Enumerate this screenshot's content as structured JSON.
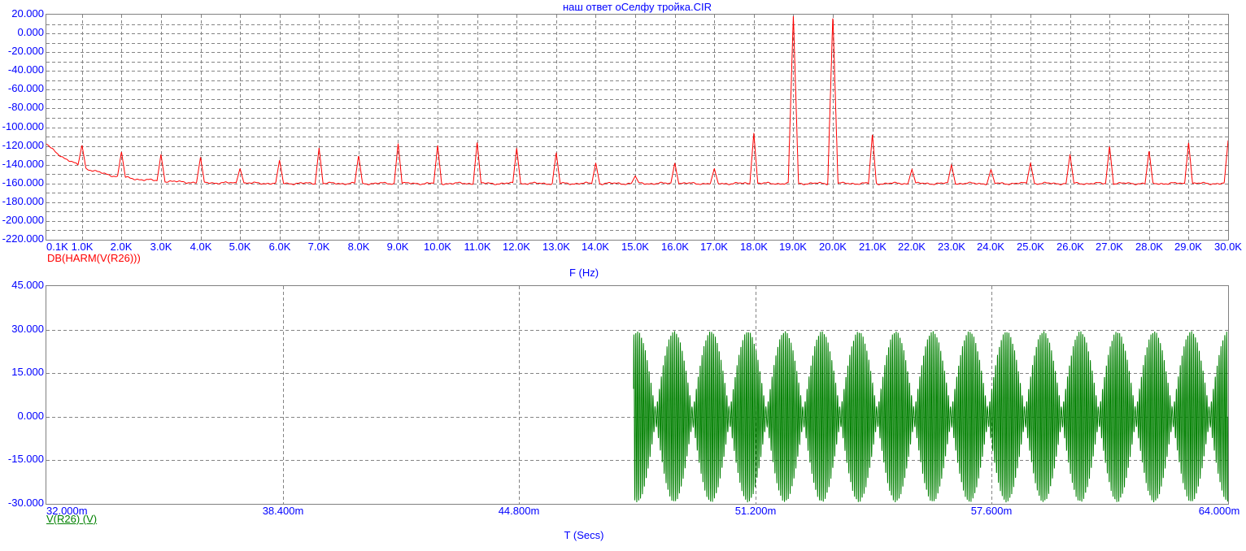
{
  "window_title": "наш ответ оСелфу тройка.CIR",
  "colors": {
    "label_blue": "#0000ff",
    "trace_red": "#ff0000",
    "trace_green": "#008000",
    "grid_gray": "#848484",
    "border_gray": "#808080",
    "background": "#ffffff"
  },
  "top_chart": {
    "series_label": "DB(HARM(V(R26)))",
    "xlabel": "F (Hz)",
    "y_ticks": [
      {
        "label": "20.000",
        "db": 20
      },
      {
        "label": "0.000",
        "db": 0
      },
      {
        "label": "-20.000",
        "db": -20
      },
      {
        "label": "-40.000",
        "db": -40
      },
      {
        "label": "-60.000",
        "db": -60
      },
      {
        "label": "-80.000",
        "db": -80
      },
      {
        "label": "-100.000",
        "db": -100
      },
      {
        "label": "-120.000",
        "db": -120
      },
      {
        "label": "-140.000",
        "db": -140
      },
      {
        "label": "-160.000",
        "db": -160
      },
      {
        "label": "-180.000",
        "db": -180
      },
      {
        "label": "-200.000",
        "db": -200
      },
      {
        "label": "-220.000",
        "db": -220
      }
    ],
    "x_ticks": [
      {
        "label": "0.1K",
        "khz": 0.1
      },
      {
        "label": "1.0K",
        "khz": 1
      },
      {
        "label": "2.0K",
        "khz": 2
      },
      {
        "label": "3.0K",
        "khz": 3
      },
      {
        "label": "4.0K",
        "khz": 4
      },
      {
        "label": "5.0K",
        "khz": 5
      },
      {
        "label": "6.0K",
        "khz": 6
      },
      {
        "label": "7.0K",
        "khz": 7
      },
      {
        "label": "8.0K",
        "khz": 8
      },
      {
        "label": "9.0K",
        "khz": 9
      },
      {
        "label": "10.0K",
        "khz": 10
      },
      {
        "label": "11.0K",
        "khz": 11
      },
      {
        "label": "12.0K",
        "khz": 12
      },
      {
        "label": "13.0K",
        "khz": 13
      },
      {
        "label": "14.0K",
        "khz": 14
      },
      {
        "label": "15.0K",
        "khz": 15
      },
      {
        "label": "16.0K",
        "khz": 16
      },
      {
        "label": "17.0K",
        "khz": 17
      },
      {
        "label": "18.0K",
        "khz": 18
      },
      {
        "label": "19.0K",
        "khz": 19
      },
      {
        "label": "20.0K",
        "khz": 20
      },
      {
        "label": "21.0K",
        "khz": 21
      },
      {
        "label": "22.0K",
        "khz": 22
      },
      {
        "label": "23.0K",
        "khz": 23
      },
      {
        "label": "24.0K",
        "khz": 24
      },
      {
        "label": "25.0K",
        "khz": 25
      },
      {
        "label": "26.0K",
        "khz": 26
      },
      {
        "label": "27.0K",
        "khz": 27
      },
      {
        "label": "28.0K",
        "khz": 28
      },
      {
        "label": "29.0K",
        "khz": 29
      },
      {
        "label": "30.0K",
        "khz": 30
      }
    ]
  },
  "bottom_chart": {
    "series_label": "V(R26) (V)",
    "xlabel": "T (Secs)",
    "y_ticks": [
      {
        "label": "45.000",
        "v": 45
      },
      {
        "label": "30.000",
        "v": 30
      },
      {
        "label": "15.000",
        "v": 15
      },
      {
        "label": "0.000",
        "v": 0
      },
      {
        "label": "-15.000",
        "v": -15
      },
      {
        "label": "-30.000",
        "v": -30
      }
    ],
    "x_ticks": [
      {
        "label": "32.000m",
        "ms": 32
      },
      {
        "label": "38.400m",
        "ms": 38.4
      },
      {
        "label": "44.800m",
        "ms": 44.8
      },
      {
        "label": "51.200m",
        "ms": 51.2
      },
      {
        "label": "57.600m",
        "ms": 57.6
      },
      {
        "label": "64.000m",
        "ms": 64
      }
    ]
  },
  "chart_data": [
    {
      "type": "line",
      "title": "наш ответ оСелфу тройка.CIR",
      "xlabel": "F (Hz)",
      "ylabel": "DB(HARM(V(R26)))",
      "legend": [
        "DB(HARM(V(R26)))"
      ],
      "series_color": "#ff0000",
      "xlim_khz": [
        0.1,
        30
      ],
      "ylim_db": [
        -220,
        20
      ],
      "grid": "dashed, major x every 1 kHz, major y every 10 dB",
      "noise_floor": {
        "start_db": -118,
        "asymptote_db": -160,
        "decay_const_khz": 1.05,
        "wiggle_db": 1
      },
      "harmonic_peaks": [
        {
          "f_khz": 1,
          "db": -119
        },
        {
          "f_khz": 2,
          "db": -126
        },
        {
          "f_khz": 3,
          "db": -129
        },
        {
          "f_khz": 4,
          "db": -132
        },
        {
          "f_khz": 5,
          "db": -144
        },
        {
          "f_khz": 6,
          "db": -135
        },
        {
          "f_khz": 7,
          "db": -122
        },
        {
          "f_khz": 8,
          "db": -130
        },
        {
          "f_khz": 9,
          "db": -117
        },
        {
          "f_khz": 10,
          "db": -119
        },
        {
          "f_khz": 11,
          "db": -116
        },
        {
          "f_khz": 12,
          "db": -122
        },
        {
          "f_khz": 13,
          "db": -127
        },
        {
          "f_khz": 14,
          "db": -138
        },
        {
          "f_khz": 15,
          "db": -152
        },
        {
          "f_khz": 16,
          "db": -138
        },
        {
          "f_khz": 17,
          "db": -144
        },
        {
          "f_khz": 18,
          "db": -106
        },
        {
          "f_khz": 19,
          "db": 20,
          "clipped_at_top": true
        },
        {
          "f_khz": 20,
          "db": 20,
          "clipped_at_top": true
        },
        {
          "f_khz": 21,
          "db": -107
        },
        {
          "f_khz": 22,
          "db": -145
        },
        {
          "f_khz": 23,
          "db": -140
        },
        {
          "f_khz": 24,
          "db": -145
        },
        {
          "f_khz": 25,
          "db": -138
        },
        {
          "f_khz": 26,
          "db": -129
        },
        {
          "f_khz": 27,
          "db": -120
        },
        {
          "f_khz": 28,
          "db": -125
        },
        {
          "f_khz": 29,
          "db": -116
        },
        {
          "f_khz": 30,
          "db": -114
        }
      ]
    },
    {
      "type": "line",
      "xlabel": "T (Secs)",
      "ylabel": "V(R26) (V)",
      "legend": [
        "V(R26) (V)"
      ],
      "series_color": "#008000",
      "xlim_ms": [
        32,
        64
      ],
      "ylim_v": [
        -30,
        45
      ],
      "grid": "dashed, major x every 6.4 ms, major y every 15 V",
      "signal": {
        "start_ms": 47.9,
        "end_ms": 64,
        "components": [
          {
            "freq_hz": 19000,
            "amp_v": 16.3
          },
          {
            "freq_hz": 20000,
            "amp_v": 13.2
          }
        ],
        "beat_envelope_hz": 1000,
        "peak_v": 29.5,
        "min_envelope_v": 3.1,
        "value_before_start": "no trace plotted before 47.9 ms"
      }
    }
  ]
}
